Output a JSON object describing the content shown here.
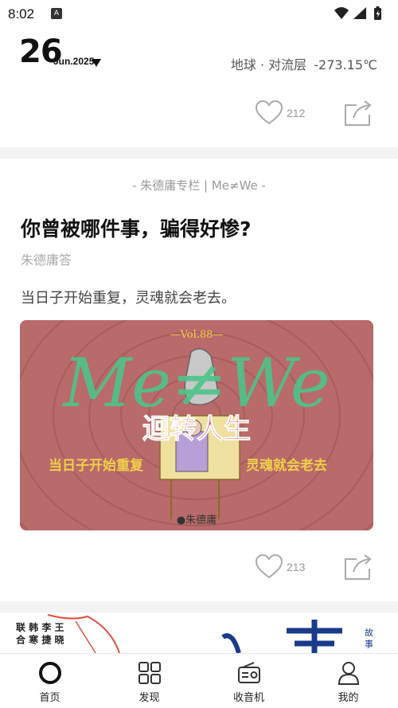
{
  "status": {
    "time": "8:02",
    "app_icon": "A"
  },
  "header": {
    "day": "26",
    "month_year": "Jun.2025",
    "location": "地球 · 对流层",
    "temperature": "-273.15℃"
  },
  "top_card": {
    "like_count": "212"
  },
  "article": {
    "column": "- 朱德庸专栏 | Me≠We -",
    "title": "你曾被哪件事，骗得好惨?",
    "author": "朱德庸答",
    "excerpt": "当日子开始重复，灵魂就会老去。",
    "cover": {
      "vol": "—Vol.88—",
      "headline": "Me≠We",
      "subtitle": "迴转人生",
      "caption_left": "当日子开始重复",
      "caption_right": "灵魂就会老去",
      "signature": "●朱德庸"
    },
    "like_count": "213"
  },
  "next_card": {
    "left_text": "联 韩 李 王\n合 寒 捷 晓",
    "right_text": "故\n事"
  },
  "tabs": [
    {
      "label": "首页",
      "icon": "home-circle-icon"
    },
    {
      "label": "发现",
      "icon": "grid-icon"
    },
    {
      "label": "收音机",
      "icon": "radio-icon"
    },
    {
      "label": "我的",
      "icon": "user-icon"
    }
  ],
  "colors": {
    "cover_bg": "#b96a6a",
    "cover_headline": "#4fc38a",
    "cover_subtitle": "#e85a6a",
    "cover_caption": "#f0d04a"
  }
}
